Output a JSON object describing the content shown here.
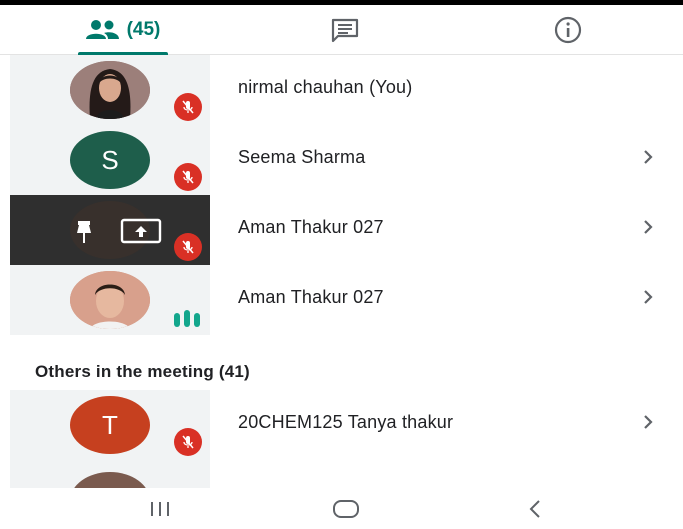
{
  "tabs": {
    "people_count": "(45)",
    "accent": "#00796b"
  },
  "participants": [
    {
      "name": "nirmal chauhan (You)"
    },
    {
      "name": "Seema Sharma",
      "initial": "S"
    },
    {
      "name": "Aman Thakur 027"
    },
    {
      "name": "Aman Thakur 027"
    }
  ],
  "section": {
    "title": "Others in the meeting (41)"
  },
  "others": [
    {
      "name": "20CHEM125 Tanya thakur",
      "initial": "T"
    }
  ],
  "colors": {
    "mute_red": "#d93025",
    "speaking_teal": "#12a68c"
  }
}
